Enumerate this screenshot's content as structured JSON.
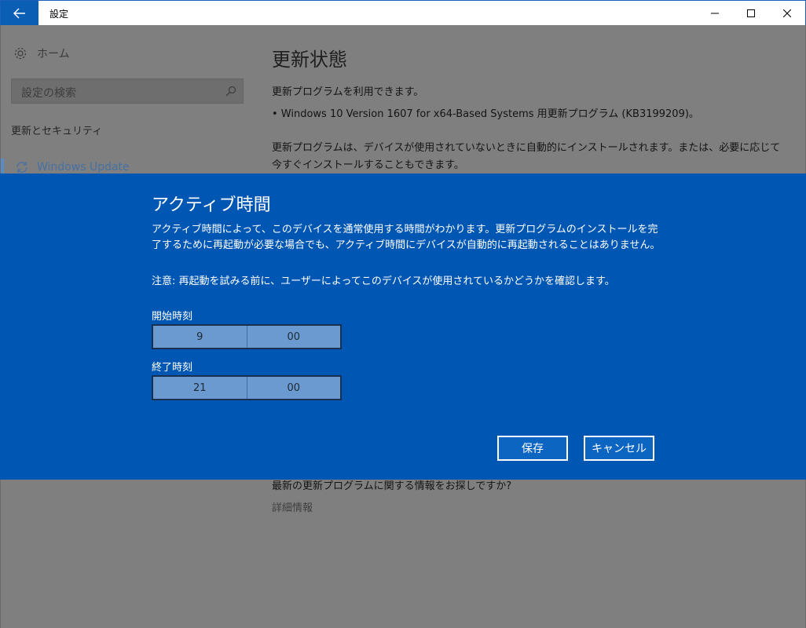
{
  "window": {
    "title": "設定"
  },
  "sidebar": {
    "home_label": "ホーム",
    "search_placeholder": "設定の検索",
    "section_label": "更新とセキュリティ",
    "items": [
      {
        "label": "Windows Update",
        "icon": "sync-icon"
      }
    ]
  },
  "main": {
    "title": "更新状態",
    "status_text": "更新プログラムを利用できます。",
    "update_item": "• Windows 10 Version 1607 for x64-Based Systems 用更新プログラム (KB3199209)。",
    "install_info": "更新プログラムは、デバイスが使用されていないときに自動的にインストールされます。または、必要に応じて今すぐインストールすることもできます。",
    "more_question": "最新の更新プログラムに関する情報をお探しですか?",
    "more_link": "詳細情報"
  },
  "dialog": {
    "title": "アクティブ時間",
    "description": "アクティブ時間によって、このデバイスを通常使用する時間がわかります。更新プログラムのインストールを完了するために再起動が必要な場合でも、アクティブ時間にデバイスが自動的に再起動されることはありません。",
    "note": "注意: 再起動を試みる前に、ユーザーによってこのデバイスが使用されているかどうかを確認します。",
    "start": {
      "label": "開始時刻",
      "hour": "9",
      "minute": "00"
    },
    "end": {
      "label": "終了時刻",
      "hour": "21",
      "minute": "00"
    },
    "save_label": "保存",
    "cancel_label": "キャンセル"
  },
  "colors": {
    "dialog_bg": "#0056b3",
    "accent": "#0a5fb4",
    "overlay": "#7f7f7f"
  }
}
